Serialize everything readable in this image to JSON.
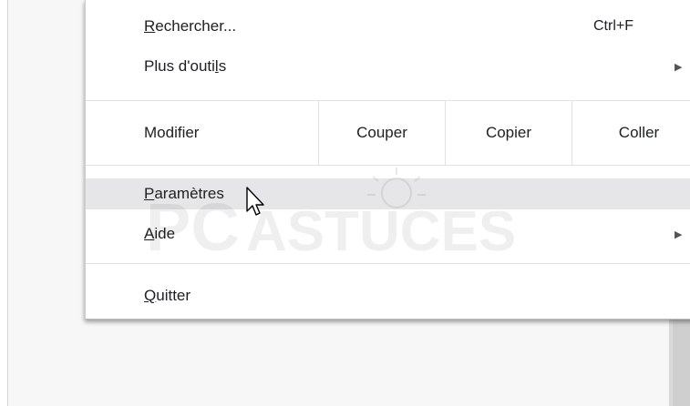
{
  "menu": {
    "find": {
      "label_u": "R",
      "label_rest": "echercher...",
      "shortcut": "Ctrl+F"
    },
    "more_tools": {
      "label_pre": "Plus d'outi",
      "label_u": "l",
      "label_post": "s",
      "arrow": "▶"
    },
    "edit": {
      "label": "Modifier",
      "cut": "Couper",
      "copy": "Copier",
      "paste": "Coller"
    },
    "settings": {
      "label_u": "P",
      "label_rest": "aramètres"
    },
    "help": {
      "label_u": "A",
      "label_rest": "ide",
      "arrow": "▶"
    },
    "quit": {
      "label_u": "Q",
      "label_rest": "uitter"
    }
  },
  "watermark": {
    "text_left": "PC",
    "text_right": "ASTUCES"
  },
  "icons": {
    "submenu": "submenu-arrow-icon",
    "cursor": "mouse-pointer-icon",
    "logo": "pcastuces-watermark-logo"
  },
  "colors": {
    "hover": "#e6e6e9",
    "separator": "#e2e2e2",
    "text": "#202124"
  }
}
